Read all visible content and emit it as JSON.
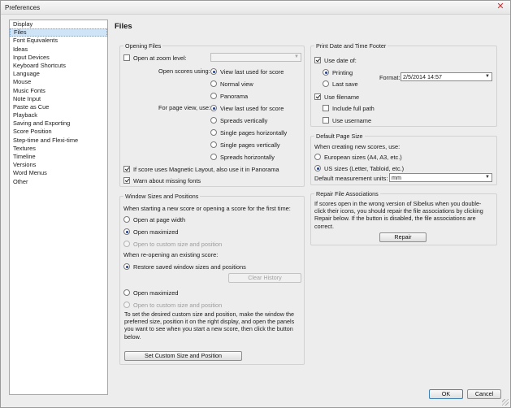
{
  "window": {
    "title": "Preferences",
    "close_glyph": "✕"
  },
  "sidebar": {
    "items": [
      "Display",
      "Files",
      "Font Equivalents",
      "Ideas",
      "Input Devices",
      "Keyboard Shortcuts",
      "Language",
      "Mouse",
      "Music Fonts",
      "Note Input",
      "Paste as Cue",
      "Playback",
      "Saving and Exporting",
      "Score Position",
      "Step-time and Flexi-time",
      "Textures",
      "Timeline",
      "Versions",
      "Word Menus",
      "Other"
    ],
    "selected": "Files"
  },
  "page_title": "Files",
  "opening_files": {
    "legend": "Opening Files",
    "open_at_zoom_label": "Open at zoom level:",
    "open_at_zoom_value": "",
    "open_scores_using_label": "Open scores using:",
    "open_scores_options": [
      "View last used for score",
      "Normal view",
      "Panorama"
    ],
    "for_page_view_label": "For page view, use:",
    "page_view_options": [
      "View last used for score",
      "Spreads vertically",
      "Single pages horizontally",
      "Single pages vertically",
      "Spreads horizontally"
    ],
    "magnetic_layout_label": "If score uses Magnetic Layout, also use it in Panorama",
    "warn_missing_fonts_label": "Warn about missing fonts"
  },
  "window_sizes": {
    "legend": "Window Sizes and Positions",
    "new_score_heading": "When starting a new score or opening a score for the first time:",
    "new_score_options": [
      "Open at page width",
      "Open maximized",
      "Open to custom size and position"
    ],
    "reopen_heading": "When re-opening an existing score:",
    "reopen_options": [
      "Restore saved window sizes and positions",
      "Open maximized",
      "Open to custom size and position"
    ],
    "clear_history_label": "Clear History",
    "instructions_lines": [
      "To set the desired custom size and position, make the window the",
      "preferred size, position it on the right display, and open the panels",
      "you want to see when you start a new score, then click the button",
      "below."
    ],
    "set_custom_label": "Set Custom Size and Position"
  },
  "print_footer": {
    "legend": "Print Date and Time Footer",
    "use_date_of_label": "Use date of:",
    "date_options": [
      "Printing",
      "Last save"
    ],
    "format_label": "Format:",
    "format_value": "2/5/2014 14:57",
    "use_filename_label": "Use filename",
    "include_full_path_label": "Include full path",
    "use_username_label": "Use username"
  },
  "page_size": {
    "legend": "Default Page Size",
    "heading": "When creating new scores, use:",
    "options": [
      "European sizes (A4, A3, etc.)",
      "US sizes (Letter, Tabloid, etc.)"
    ],
    "units_label": "Default measurement units:",
    "units_value": "mm"
  },
  "repair": {
    "legend": "Repair File Associations",
    "text_lines": [
      "If scores open in the wrong version of Sibelius when you double-",
      "click their icons, you should repair the file associations by clicking",
      "Repair below. If the button is disabled, the file associations are",
      "correct."
    ],
    "button_label": "Repair"
  },
  "footer": {
    "ok_label": "OK",
    "cancel_label": "Cancel"
  }
}
